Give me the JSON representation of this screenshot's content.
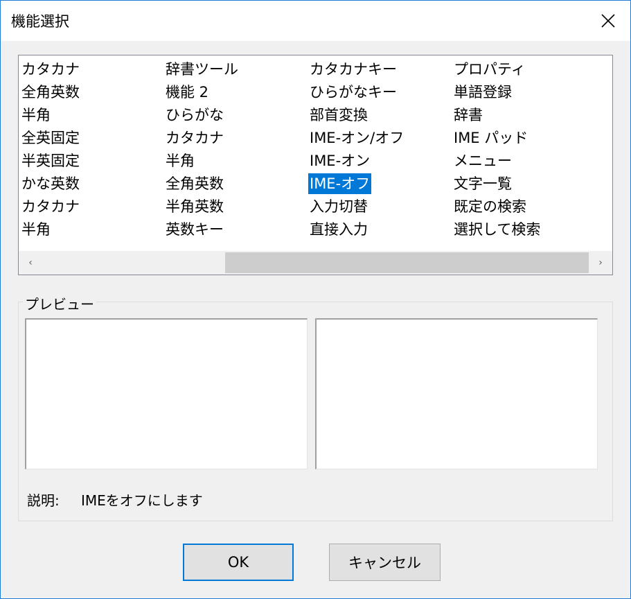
{
  "window": {
    "title": "機能選択"
  },
  "list": {
    "columns": [
      [
        "カタカナ",
        "全角英数",
        "半角",
        "全英固定",
        "半英固定",
        "かな英数",
        "カタカナ",
        "半角"
      ],
      [
        "辞書ツール",
        "機能 2",
        "ひらがな",
        "カタカナ",
        "半角",
        "全角英数",
        "半角英数",
        "英数キー"
      ],
      [
        "カタカナキー",
        "ひらがなキー",
        "部首変換",
        "IME-オン/オフ",
        "IME-オン",
        "IME-オフ",
        "入力切替",
        "直接入力"
      ],
      [
        "プロパティ",
        "単語登録",
        "辞書",
        "IME パッド",
        "メニュー",
        "文字一覧",
        "既定の検索",
        "選択して検索"
      ]
    ],
    "selected": "IME-オフ",
    "scroll_left_icon": "chevron-left",
    "scroll_right_icon": "chevron-right"
  },
  "preview": {
    "label": "プレビュー"
  },
  "description": {
    "label": "説明:",
    "text": "IMEをオフにします"
  },
  "buttons": {
    "ok": "OK",
    "cancel": "キャンセル"
  },
  "colors": {
    "selection": "#0078d7",
    "border_accent": "#1e7bd6"
  }
}
